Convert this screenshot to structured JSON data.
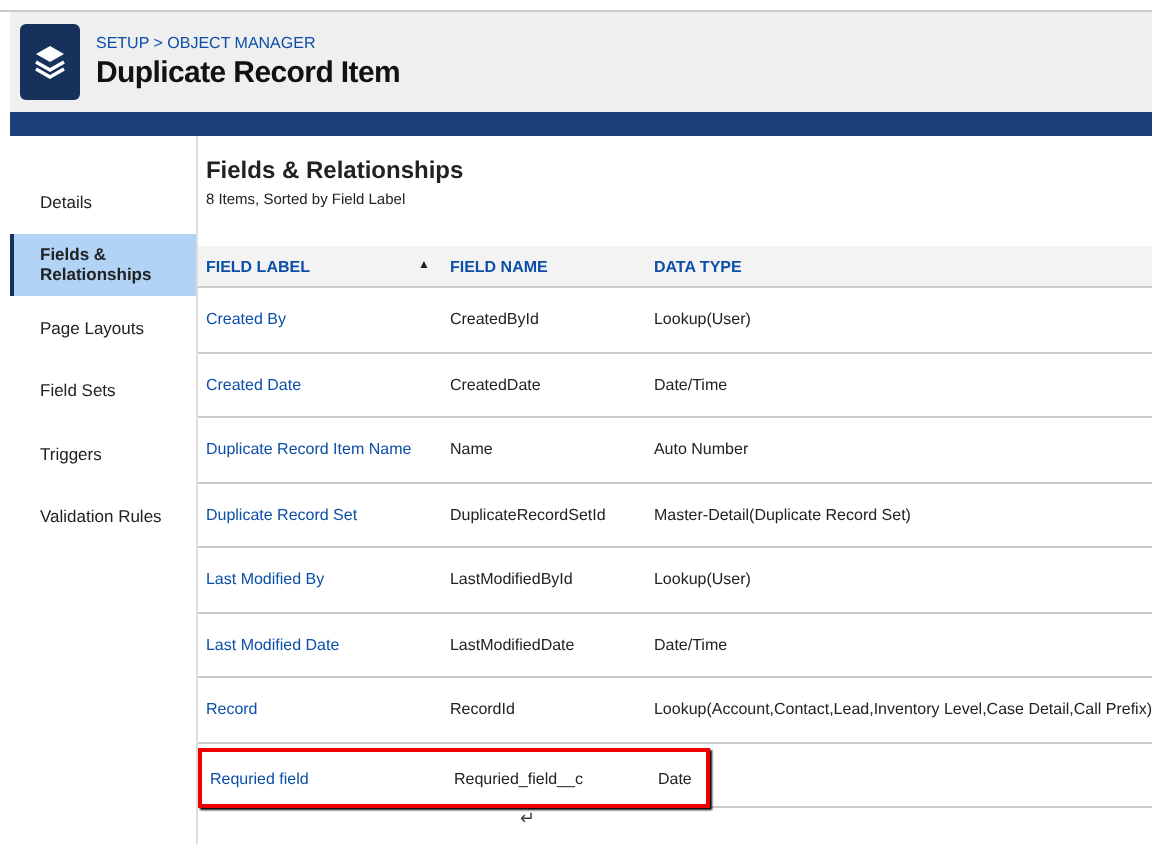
{
  "header": {
    "breadcrumb": "SETUP > OBJECT MANAGER",
    "title": "Duplicate Record Item"
  },
  "sidebar": {
    "items": [
      {
        "label": "Details",
        "selected": false
      },
      {
        "label": "Fields & Relationships",
        "selected": true
      },
      {
        "label": "Page Layouts",
        "selected": false
      },
      {
        "label": "Field Sets",
        "selected": false
      },
      {
        "label": "Triggers",
        "selected": false
      },
      {
        "label": "Validation Rules",
        "selected": false
      }
    ]
  },
  "main": {
    "title": "Fields & Relationships",
    "subtitle": "8 Items, Sorted by Field Label"
  },
  "table": {
    "columns": [
      {
        "label": "FIELD LABEL",
        "sort_indicator": "▲"
      },
      {
        "label": "FIELD NAME"
      },
      {
        "label": "DATA TYPE"
      }
    ],
    "rows": [
      {
        "field_label": "Created By",
        "field_name": "CreatedById",
        "data_type": "Lookup(User)",
        "highlighted": false
      },
      {
        "field_label": "Created Date",
        "field_name": "CreatedDate",
        "data_type": "Date/Time",
        "highlighted": false
      },
      {
        "field_label": "Duplicate Record Item Name",
        "field_name": "Name",
        "data_type": "Auto Number",
        "highlighted": false
      },
      {
        "field_label": "Duplicate Record Set",
        "field_name": "DuplicateRecordSetId",
        "data_type": "Master-Detail(Duplicate Record Set)",
        "highlighted": false
      },
      {
        "field_label": "Last Modified By",
        "field_name": "LastModifiedById",
        "data_type": "Lookup(User)",
        "highlighted": false
      },
      {
        "field_label": "Last Modified Date",
        "field_name": "LastModifiedDate",
        "data_type": "Date/Time",
        "highlighted": false
      },
      {
        "field_label": "Record",
        "field_name": "RecordId",
        "data_type": "Lookup(Account,Contact,Lead,Inventory Level,Case Detail,Call Prefix)",
        "highlighted": false
      },
      {
        "field_label": "Requried field",
        "field_name": "Requried_field__c",
        "data_type": "Date",
        "highlighted": true
      }
    ]
  },
  "footer_mark": "↵"
}
